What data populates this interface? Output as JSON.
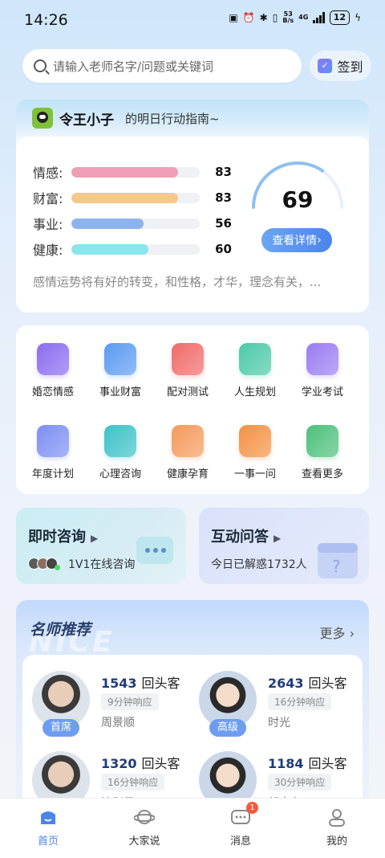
{
  "status": {
    "time": "14:26",
    "net_speed": "53",
    "net_unit": "B/s",
    "net_type": "4G",
    "battery": "12"
  },
  "search": {
    "placeholder": "请输入老师名字/问题或关键词",
    "signin_label": "签到"
  },
  "guide": {
    "user": "令王小子",
    "subtitle": "的明日行动指南~",
    "metrics": [
      {
        "label": "情感:",
        "value": 83,
        "color": "#ee9fb5"
      },
      {
        "label": "财富:",
        "value": 83,
        "color": "#f6c88c"
      },
      {
        "label": "事业:",
        "value": 56,
        "color": "#8cb3ee"
      },
      {
        "label": "健康:",
        "value": 60,
        "color": "#8be5ec"
      }
    ],
    "score": "69",
    "detail_button": "查看详情",
    "summary": "感情运势将有好的转变，和性格，才华，理念有关，..."
  },
  "services": [
    {
      "label": "婚恋情感",
      "icon": "love-letter-icon",
      "color": "#8a6cf0"
    },
    {
      "label": "事业财富",
      "icon": "money-bag-icon",
      "color": "#5b9af2"
    },
    {
      "label": "配对测试",
      "icon": "heart-flag-icon",
      "color": "#f16a6a"
    },
    {
      "label": "人生规划",
      "icon": "scroll-icon",
      "color": "#4cc9a8"
    },
    {
      "label": "学业考试",
      "icon": "folder-pen-icon",
      "color": "#9a7cf2"
    },
    {
      "label": "年度计划",
      "icon": "calendar-flame-icon",
      "color": "#7d8ef3"
    },
    {
      "label": "心理咨询",
      "icon": "heart-screen-icon",
      "color": "#3cc2c9"
    },
    {
      "label": "健康孕育",
      "icon": "magnifier-hand-icon",
      "color": "#f59a5c"
    },
    {
      "label": "一事一问",
      "icon": "note-icon",
      "color": "#f59144"
    },
    {
      "label": "查看更多",
      "icon": "cash-icon",
      "color": "#4cc07a"
    }
  ],
  "instant": {
    "title": "即时咨询",
    "sub": "1V1在线咨询"
  },
  "qa": {
    "title": "互动问答",
    "sub": "今日已解惑1732人"
  },
  "masters": {
    "title": "名师推荐",
    "watermark": "NICE",
    "more": "更多",
    "list": [
      {
        "count": "1543",
        "unit": "回头客",
        "response": "9分钟响应",
        "name": "周景顺",
        "badge": "首席"
      },
      {
        "count": "2643",
        "unit": "回头客",
        "response": "16分钟响应",
        "name": "时光",
        "badge": "高级"
      },
      {
        "count": "1320",
        "unit": "回头客",
        "response": "16分钟响应",
        "name": "沈則尋",
        "badge": ""
      },
      {
        "count": "1184",
        "unit": "回头客",
        "response": "30分钟响应",
        "name": "郭宏存",
        "badge": ""
      }
    ]
  },
  "tabs": [
    {
      "label": "首页",
      "icon": "home-icon"
    },
    {
      "label": "大家说",
      "icon": "planet-icon"
    },
    {
      "label": "消息",
      "icon": "message-icon",
      "badge": "1"
    },
    {
      "label": "我的",
      "icon": "profile-icon"
    }
  ]
}
